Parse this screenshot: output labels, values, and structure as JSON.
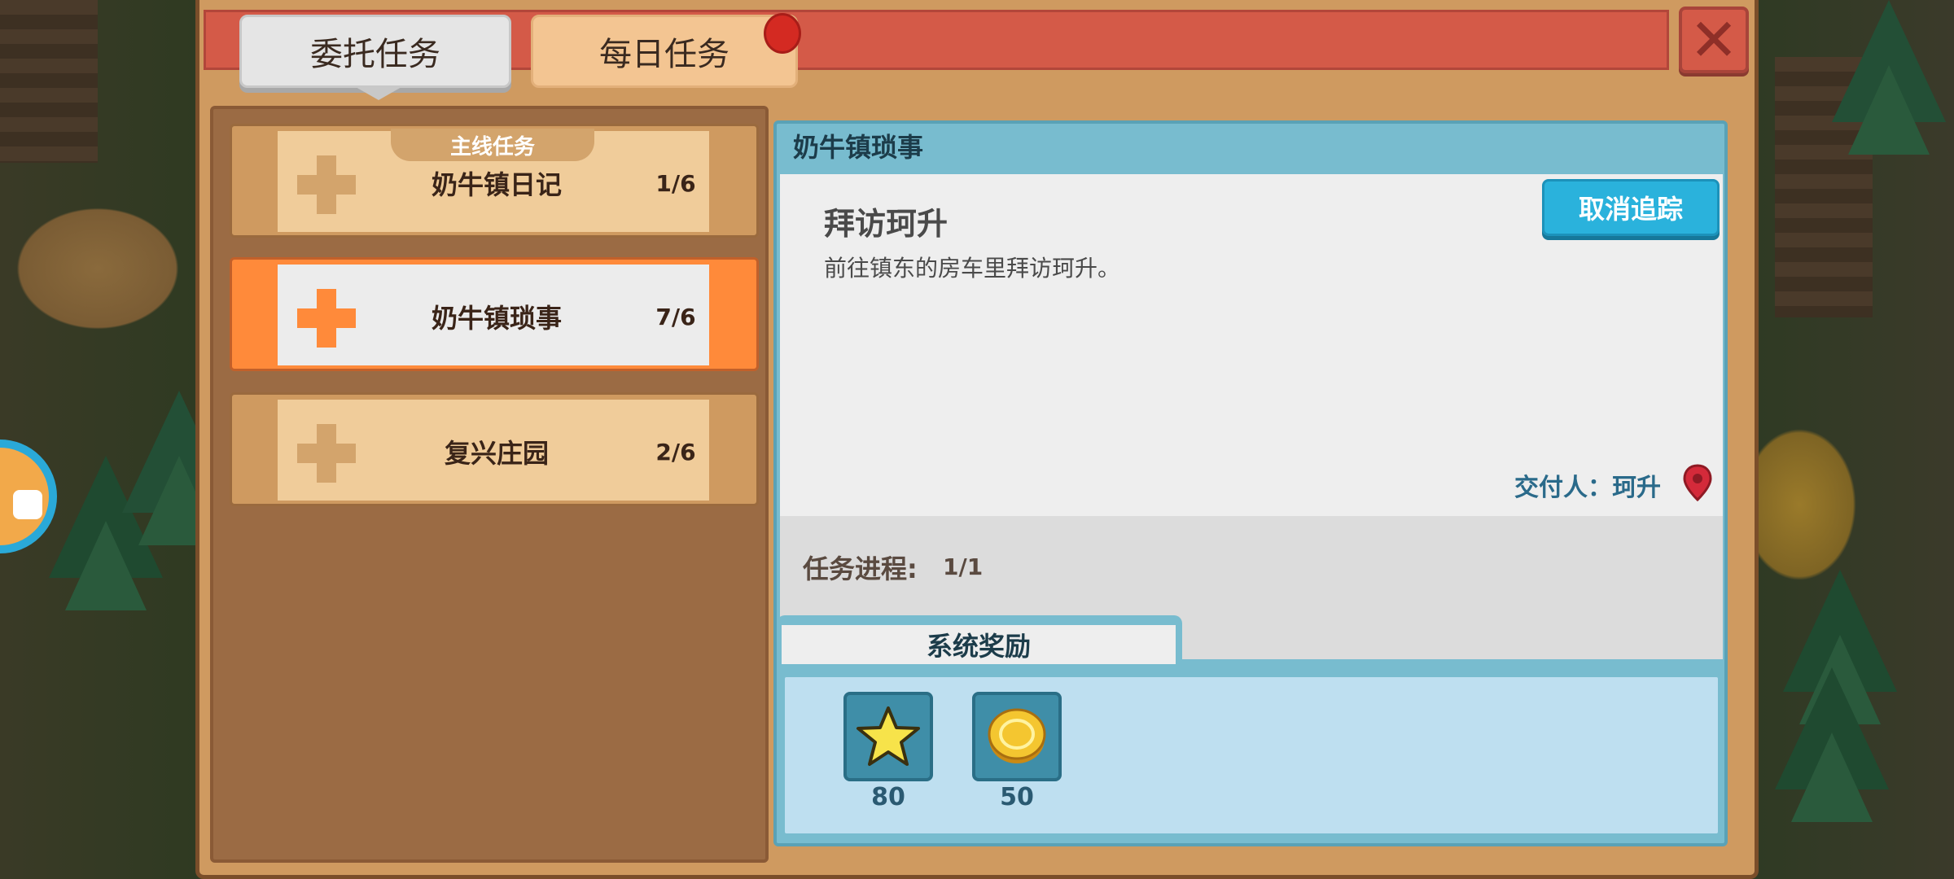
{
  "tabs": [
    {
      "label": "委托任务",
      "active": true
    },
    {
      "label": "每日任务",
      "active": false,
      "has_notification": true
    }
  ],
  "quest_list": {
    "category_label": "主线任务",
    "items": [
      {
        "name": "奶牛镇日记",
        "progress": "1/6",
        "selected": false
      },
      {
        "name": "奶牛镇琐事",
        "progress": "7/6",
        "selected": true
      },
      {
        "name": "复兴庄园",
        "progress": "2/6",
        "selected": false
      }
    ]
  },
  "detail": {
    "title": "奶牛镇琐事",
    "step_title": "拜访珂升",
    "step_description": "前往镇东的房车里拜访珂升。",
    "cancel_button": "取消追踪",
    "giver": "交付人：珂升",
    "progress_label": "任务进程:",
    "progress_value": "1/1",
    "reward_tab": "系统奖励",
    "rewards": [
      {
        "icon": "star-icon",
        "amount": "80"
      },
      {
        "icon": "gold-coin-icon",
        "amount": "50"
      }
    ]
  },
  "colors": {
    "header": "#d45a48",
    "selected_accent": "#ff8a3a",
    "detail_frame": "#78bccf",
    "cancel_button": "#2ab2dc"
  }
}
